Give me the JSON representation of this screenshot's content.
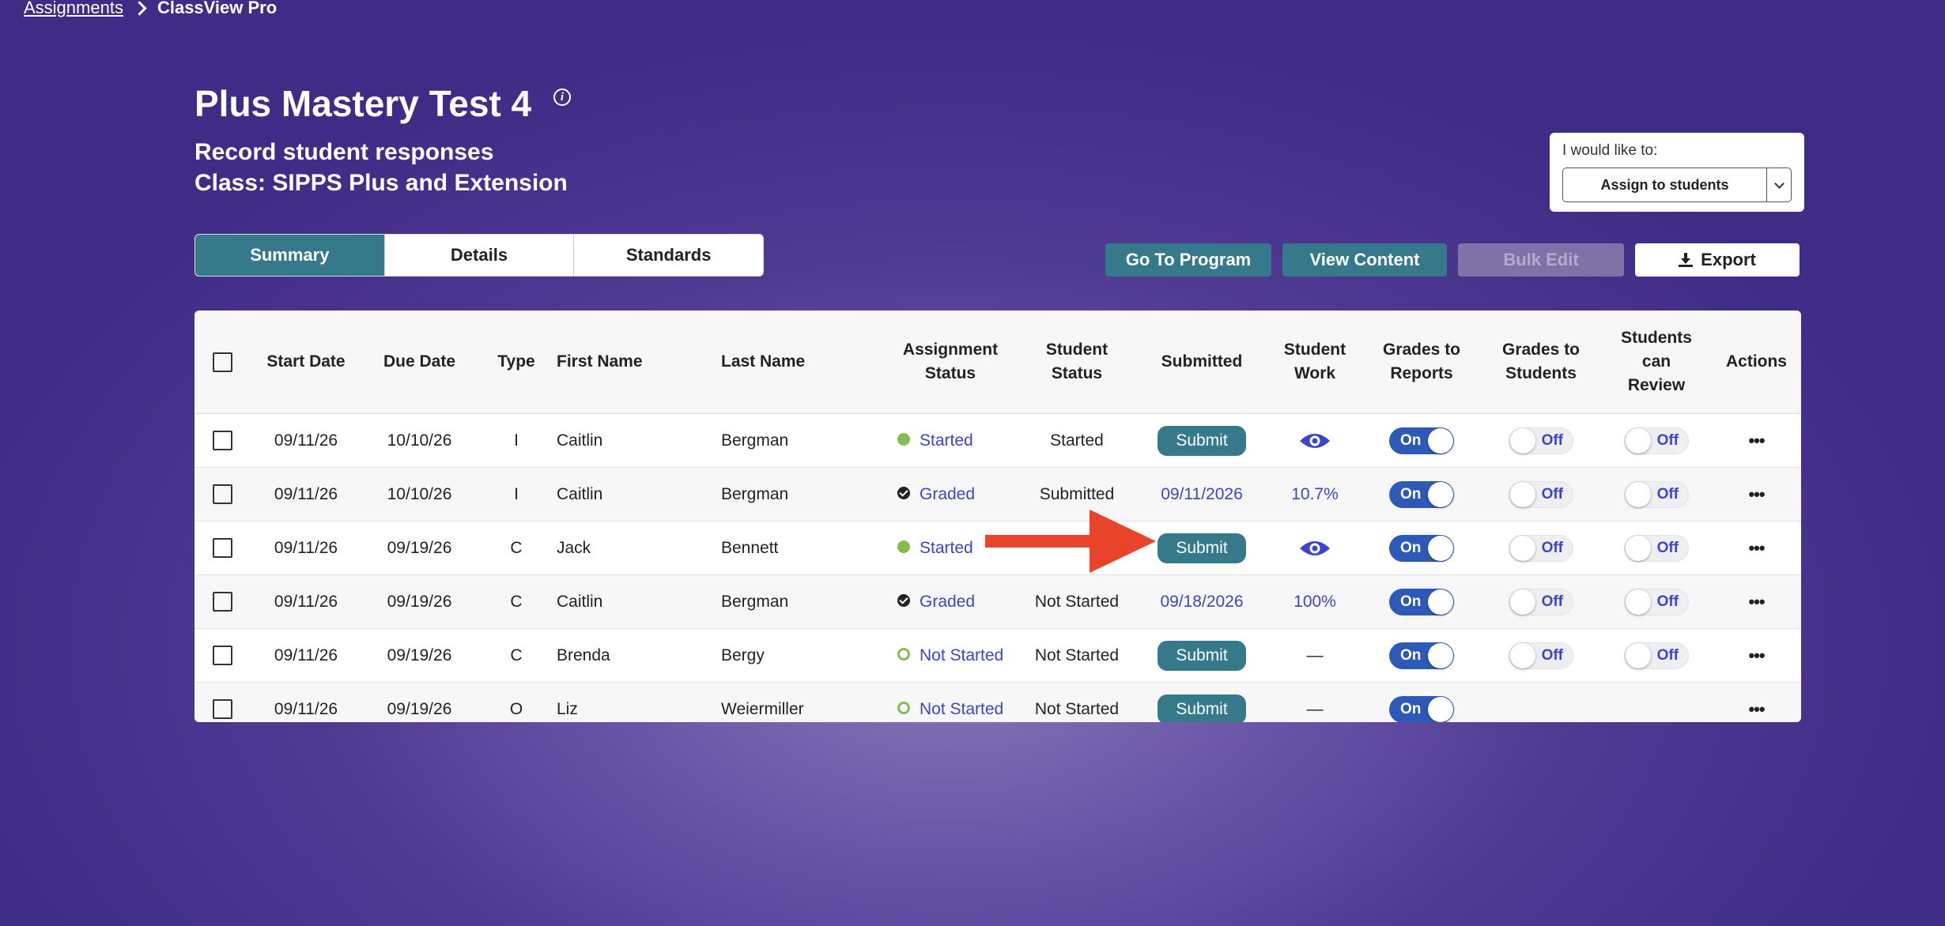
{
  "breadcrumb": {
    "parent": "Assignments",
    "current": "ClassView Pro"
  },
  "header": {
    "title": "Plus Mastery Test 4",
    "subtitle": "Record student responses",
    "class_line": "Class: SIPPS Plus and Extension"
  },
  "would_like": {
    "label": "I would like to:",
    "selected": "Assign to students"
  },
  "tabs": [
    {
      "label": "Summary",
      "active": true
    },
    {
      "label": "Details",
      "active": false
    },
    {
      "label": "Standards",
      "active": false
    }
  ],
  "actions": {
    "go_to_program": "Go To Program",
    "view_content": "View Content",
    "bulk_edit": "Bulk Edit",
    "export": "Export"
  },
  "table": {
    "headers": {
      "start_date": "Start Date",
      "due_date": "Due Date",
      "type": "Type",
      "first_name": "First Name",
      "last_name": "Last Name",
      "assignment_status": [
        "Assignment",
        "Status"
      ],
      "student_status": [
        "Student",
        "Status"
      ],
      "submitted": "Submitted",
      "student_work": [
        "Student",
        "Work"
      ],
      "grades_to_reports": [
        "Grades to",
        "Reports"
      ],
      "grades_to_students": [
        "Grades to",
        "Students"
      ],
      "students_can_review": [
        "Students",
        "can",
        "Review"
      ],
      "actions": "Actions"
    },
    "toggle_on_label": "On",
    "toggle_off_label": "Off",
    "rows": [
      {
        "start": "09/11/26",
        "due": "10/10/26",
        "type": "I",
        "first": "Caitlin",
        "last": "Bergman",
        "assign_status": "Started",
        "student_status": "Started",
        "submitted": "Submit",
        "work": "",
        "reports": "On",
        "students": "Off",
        "review": "Off"
      },
      {
        "start": "09/11/26",
        "due": "10/10/26",
        "type": "I",
        "first": "Caitlin",
        "last": "Bergman",
        "assign_status": "Graded",
        "student_status": "Submitted",
        "submitted": "09/11/2026",
        "work": "10.7%",
        "reports": "On",
        "students": "Off",
        "review": "Off"
      },
      {
        "start": "09/11/26",
        "due": "09/19/26",
        "type": "C",
        "first": "Jack",
        "last": "Bennett",
        "assign_status": "Started",
        "student_status": "",
        "submitted": "Submit",
        "work": "",
        "reports": "On",
        "students": "Off",
        "review": "Off"
      },
      {
        "start": "09/11/26",
        "due": "09/19/26",
        "type": "C",
        "first": "Caitlin",
        "last": "Bergman",
        "assign_status": "Graded",
        "student_status": "Not Started",
        "submitted": "09/18/2026",
        "work": "100%",
        "reports": "On",
        "students": "Off",
        "review": "Off"
      },
      {
        "start": "09/11/26",
        "due": "09/19/26",
        "type": "C",
        "first": "Brenda",
        "last": "Bergy",
        "assign_status": "Not Started",
        "student_status": "Not Started",
        "submitted": "Submit",
        "work": "—",
        "reports": "On",
        "students": "Off",
        "review": "Off"
      },
      {
        "start": "09/11/26",
        "due": "09/19/26",
        "type": "O",
        "first": "Liz",
        "last": "Weiermiller",
        "assign_status": "Not Started",
        "student_status": "Not Started",
        "submitted": "Submit",
        "work": "—",
        "reports": "On",
        "students": "",
        "review": ""
      }
    ]
  },
  "icons": {
    "info": "info-icon",
    "checkbox": "checkbox",
    "view": "eye-icon",
    "more": "more-icon",
    "export": "download-icon",
    "annotation": "red-arrow"
  },
  "colors": {
    "teal": "#36798a",
    "link": "#3c45c7",
    "toggle_on": "#2d59b8",
    "status_green": "#86bd4f",
    "arrow": "#e8442c"
  }
}
